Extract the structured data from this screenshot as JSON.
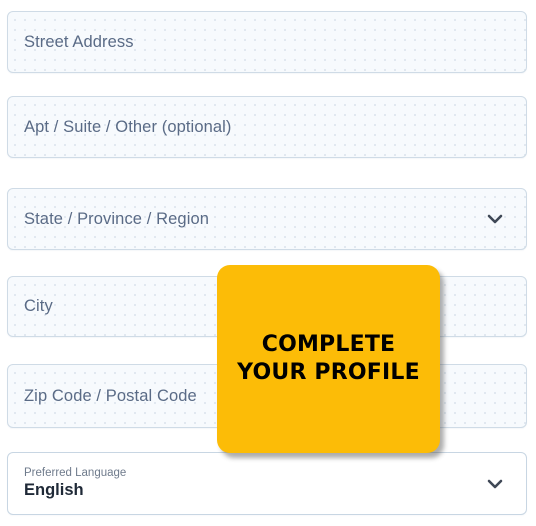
{
  "form": {
    "fields": [
      {
        "name": "street-address",
        "placeholder": "Street Address",
        "type": "text"
      },
      {
        "name": "apt-suite-other",
        "placeholder": "Apt / Suite / Other (optional)",
        "type": "text"
      },
      {
        "name": "state-province-region",
        "placeholder": "State / Province / Region",
        "type": "select",
        "icon": "chevron-down-icon"
      },
      {
        "name": "city",
        "placeholder": "City",
        "type": "text"
      },
      {
        "name": "zip-postal-code",
        "placeholder": "Zip Code / Postal Code",
        "type": "text"
      }
    ],
    "language_select": {
      "label": "Preferred Language",
      "value": "English",
      "icon": "chevron-down-icon"
    }
  },
  "callout": {
    "line1": "COMPLETE",
    "line2": "YOUR PROFILE",
    "background_color": "#fcbc07",
    "text_color": "#000000"
  },
  "colors": {
    "field_background": "#f7fafd",
    "field_border": "#cfdbe6",
    "placeholder_text": "#5a6b86",
    "value_text": "#1f2937",
    "label_text": "#6f7b8c",
    "page_background": "#ffffff",
    "accent_yellow": "#fcbc07"
  }
}
